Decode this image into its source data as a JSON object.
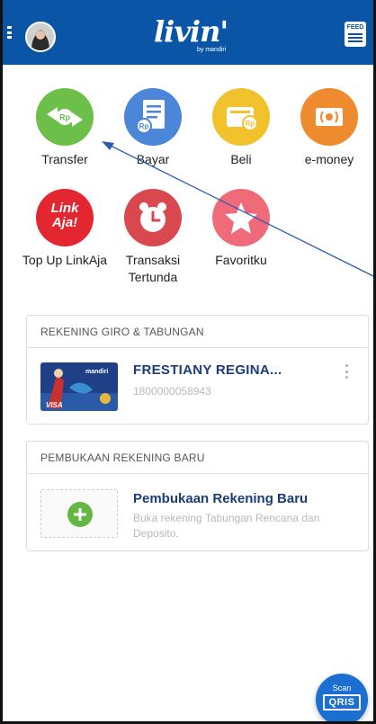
{
  "header": {
    "logo_text": "livin'",
    "logo_subtext": "by mandiri",
    "feed_label": "FEED"
  },
  "menu": {
    "items": [
      {
        "label": "Transfer",
        "icon": "transfer-icon",
        "color": "#6cc04a"
      },
      {
        "label": "Bayar",
        "icon": "bill-icon",
        "color": "#4b86d8"
      },
      {
        "label": "Beli",
        "icon": "wallet-icon",
        "color": "#f2c22d"
      },
      {
        "label": "e-money",
        "icon": "emoney-card-icon",
        "color": "#ee8b2f"
      },
      {
        "label": "Top Up LinkAja",
        "icon": "linkaja-icon",
        "color": "#e3262f"
      },
      {
        "label": "Transaksi Tertunda",
        "icon": "alarm-clock-icon",
        "color": "#d9474f"
      },
      {
        "label": "Favoritku",
        "icon": "star-icon",
        "color": "#f06b7a"
      }
    ],
    "linkaja_logo_line1": "Link",
    "linkaja_logo_line2": "Aja!"
  },
  "accounts_section": {
    "title": "REKENING GIRO & TABUNGAN",
    "account_name": "FRESTIANY REGINA...",
    "account_number": "1800000058943",
    "card_brand_text": "mandiri",
    "card_visa_text": "VISA"
  },
  "new_account_section": {
    "title": "PEMBUKAAN REKENING BARU",
    "item_title": "Pembukaan Rekening Baru",
    "item_description": "Buka rekening Tabungan Rencana dan Deposito."
  },
  "scan_button": {
    "label": "Scan",
    "qris_text": "QRIS"
  },
  "colors": {
    "header_blue": "#0b55a7",
    "account_name_blue": "#1a3d7a",
    "annotation_line": "#2d5bb0"
  }
}
